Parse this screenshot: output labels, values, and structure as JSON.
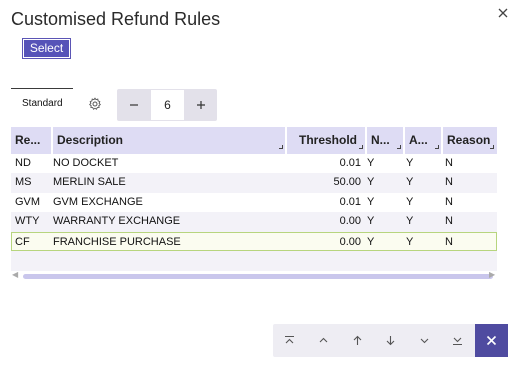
{
  "dialog": {
    "title": "Customised Refund Rules",
    "close_icon": "close-icon"
  },
  "toolbar": {
    "select_label": "Select",
    "tab_label": "Standard",
    "settings_icon": "gear-icon",
    "stepper_value": "6",
    "decrement_icon": "minus-icon",
    "increment_icon": "plus-icon"
  },
  "table": {
    "columns": [
      {
        "label": "Re..."
      },
      {
        "label": "Description"
      },
      {
        "label": "Threshold"
      },
      {
        "label": "N..."
      },
      {
        "label": "A..."
      },
      {
        "label": "Reason"
      }
    ],
    "rows": [
      {
        "code": "ND",
        "description": "NO DOCKET",
        "threshold": "0.01",
        "n": "Y",
        "a": "Y",
        "reason": "N"
      },
      {
        "code": "MS",
        "description": "MERLIN SALE",
        "threshold": "50.00",
        "n": "Y",
        "a": "Y",
        "reason": "N"
      },
      {
        "code": "GVM",
        "description": "GVM EXCHANGE",
        "threshold": "0.01",
        "n": "Y",
        "a": "Y",
        "reason": "N"
      },
      {
        "code": "WTY",
        "description": "WARRANTY EXCHANGE",
        "threshold": "0.00",
        "n": "Y",
        "a": "Y",
        "reason": "N"
      },
      {
        "code": "CF",
        "description": "FRANCHISE PURCHASE",
        "threshold": "0.00",
        "n": "Y",
        "a": "Y",
        "reason": "N"
      }
    ],
    "selected_row_index": 4
  },
  "navigation": {
    "buttons": [
      "first-page-icon",
      "previous-page-icon",
      "up-icon",
      "down-icon",
      "next-page-icon",
      "last-page-icon"
    ],
    "close_icon": "close-icon"
  },
  "colors": {
    "accent": "#5653b8",
    "header_bg": "#dedcf4",
    "selected_row_border": "#b7d57e",
    "nav_close_bg": "#4f4ba0"
  }
}
